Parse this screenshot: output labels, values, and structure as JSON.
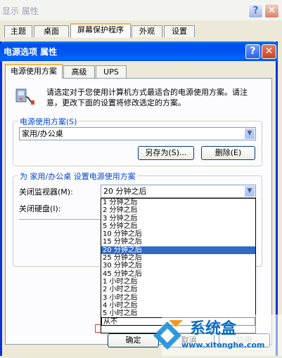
{
  "back_window": {
    "title": "显示 属性",
    "tabs": [
      "主题",
      "桌面",
      "屏幕保护程序",
      "外观",
      "设置"
    ],
    "selected_tab": 2
  },
  "dialog": {
    "title": "电源选项 属性",
    "tabs": [
      "电源使用方案",
      "高级",
      "UPS"
    ],
    "selected_tab": 0,
    "description": "请选定对于您使用计算机方式最适合的电源使用方案。请注意，更改下面的设置将修改选定的方案。",
    "schemes_group": {
      "label": "电源使用方案(S)",
      "selected": "家用/办公桌",
      "save_as_label": "另存为(S)...",
      "delete_label": "删除(E)"
    },
    "settings_group": {
      "label": "为 家用/办公桌 设置电源使用方案",
      "monitor_label": "关闭监视器(M):",
      "monitor_value": "20 分钟之后",
      "disk_label": "关闭硬盘(I):"
    },
    "dropdown_options": [
      "1 分钟之后",
      "2 分钟之后",
      "3 分钟之后",
      "5 分钟之后",
      "10 分钟之后",
      "15 分钟之后",
      "20 分钟之后",
      "25 分钟之后",
      "30 分钟之后",
      "45 分钟之后",
      "1 小时之后",
      "2 小时之后",
      "3 小时之后",
      "4 小时之后",
      "5 小时之后",
      "从不"
    ],
    "dropdown_selected_index": 6,
    "ok_label": "确定",
    "cancel_label": "取消",
    "apply_label": "应用"
  },
  "watermark": {
    "brand": "系统盒",
    "url": "www.xitonghe.com"
  },
  "colors": {
    "title_blue": "#0053ee",
    "selection": "#316ac5",
    "group_label": "#0046d5",
    "tab_highlight": "#f7b64a"
  }
}
